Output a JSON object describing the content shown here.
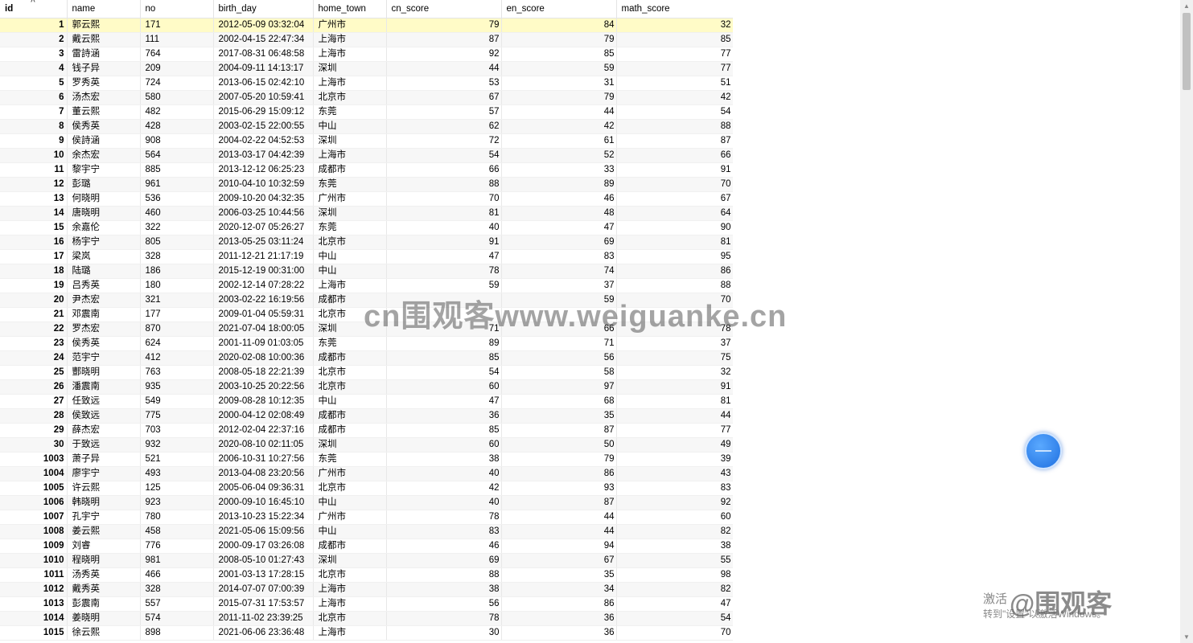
{
  "columns": [
    "id",
    "name",
    "no",
    "birth_day",
    "home_town",
    "cn_score",
    "en_score",
    "math_score"
  ],
  "rows": [
    [
      "1",
      "郭云熙",
      "171",
      "2012-05-09 03:32:04",
      "广州市",
      "79",
      "84",
      "32"
    ],
    [
      "2",
      "戴云熙",
      "111",
      "2002-04-15 22:47:34",
      "上海市",
      "87",
      "79",
      "85"
    ],
    [
      "3",
      "雷詩涵",
      "764",
      "2017-08-31 06:48:58",
      "上海市",
      "92",
      "85",
      "77"
    ],
    [
      "4",
      "钱子异",
      "209",
      "2004-09-11 14:13:17",
      "深圳",
      "44",
      "59",
      "77"
    ],
    [
      "5",
      "罗秀英",
      "724",
      "2013-06-15 02:42:10",
      "上海市",
      "53",
      "31",
      "51"
    ],
    [
      "6",
      "汤杰宏",
      "580",
      "2007-05-20 10:59:41",
      "北京市",
      "67",
      "79",
      "42"
    ],
    [
      "7",
      "董云熙",
      "482",
      "2015-06-29 15:09:12",
      "东莞",
      "57",
      "44",
      "54"
    ],
    [
      "8",
      "侯秀英",
      "428",
      "2003-02-15 22:00:55",
      "中山",
      "62",
      "42",
      "88"
    ],
    [
      "9",
      "侯詩涵",
      "908",
      "2004-02-22 04:52:53",
      "深圳",
      "72",
      "61",
      "87"
    ],
    [
      "10",
      "余杰宏",
      "564",
      "2013-03-17 04:42:39",
      "上海市",
      "54",
      "52",
      "66"
    ],
    [
      "11",
      "黎宇宁",
      "885",
      "2013-12-12 06:25:23",
      "成都市",
      "66",
      "33",
      "91"
    ],
    [
      "12",
      "彭璐",
      "961",
      "2010-04-10 10:32:59",
      "东莞",
      "88",
      "89",
      "70"
    ],
    [
      "13",
      "何晓明",
      "536",
      "2009-10-20 04:32:35",
      "广州市",
      "70",
      "46",
      "67"
    ],
    [
      "14",
      "唐晓明",
      "460",
      "2006-03-25 10:44:56",
      "深圳",
      "81",
      "48",
      "64"
    ],
    [
      "15",
      "余嘉伦",
      "322",
      "2020-12-07 05:26:27",
      "东莞",
      "40",
      "47",
      "90"
    ],
    [
      "16",
      "杨宇宁",
      "805",
      "2013-05-25 03:11:24",
      "北京市",
      "91",
      "69",
      "81"
    ],
    [
      "17",
      "梁岚",
      "328",
      "2011-12-21 21:17:19",
      "中山",
      "47",
      "83",
      "95"
    ],
    [
      "18",
      "陆璐",
      "186",
      "2015-12-19 00:31:00",
      "中山",
      "78",
      "74",
      "86"
    ],
    [
      "19",
      "吕秀英",
      "180",
      "2002-12-14 07:28:22",
      "上海市",
      "59",
      "37",
      "88"
    ],
    [
      "20",
      "尹杰宏",
      "321",
      "2003-02-22 16:19:56",
      "成都市",
      "",
      "59",
      "70"
    ],
    [
      "21",
      "邓震南",
      "177",
      "2009-01-04 05:59:31",
      "北京市",
      "",
      "",
      "",
      ""
    ],
    [
      "22",
      "罗杰宏",
      "870",
      "2021-07-04 18:00:05",
      "深圳",
      "71",
      "66",
      "78"
    ],
    [
      "23",
      "侯秀英",
      "624",
      "2001-11-09 01:03:05",
      "东莞",
      "89",
      "71",
      "37"
    ],
    [
      "24",
      "范宇宁",
      "412",
      "2020-02-08 10:00:36",
      "成都市",
      "85",
      "56",
      "75"
    ],
    [
      "25",
      "酆晓明",
      "763",
      "2008-05-18 22:21:39",
      "北京市",
      "54",
      "58",
      "32"
    ],
    [
      "26",
      "潘震南",
      "935",
      "2003-10-25 20:22:56",
      "北京市",
      "60",
      "97",
      "91"
    ],
    [
      "27",
      "任致远",
      "549",
      "2009-08-28 10:12:35",
      "中山",
      "47",
      "68",
      "81"
    ],
    [
      "28",
      "侯致远",
      "775",
      "2000-04-12 02:08:49",
      "成都市",
      "36",
      "35",
      "44"
    ],
    [
      "29",
      "薛杰宏",
      "703",
      "2012-02-04 22:37:16",
      "成都市",
      "85",
      "87",
      "77"
    ],
    [
      "30",
      "于致远",
      "932",
      "2020-08-10 02:11:05",
      "深圳",
      "60",
      "50",
      "49"
    ],
    [
      "1003",
      "萧子异",
      "521",
      "2006-10-31 10:27:56",
      "东莞",
      "38",
      "79",
      "39"
    ],
    [
      "1004",
      "廖宇宁",
      "493",
      "2013-04-08 23:20:56",
      "广州市",
      "40",
      "86",
      "43"
    ],
    [
      "1005",
      "许云熙",
      "125",
      "2005-06-04 09:36:31",
      "北京市",
      "42",
      "93",
      "83"
    ],
    [
      "1006",
      "韩晓明",
      "923",
      "2000-09-10 16:45:10",
      "中山",
      "40",
      "87",
      "92"
    ],
    [
      "1007",
      "孔宇宁",
      "780",
      "2013-10-23 15:22:34",
      "广州市",
      "78",
      "44",
      "60"
    ],
    [
      "1008",
      "姜云熙",
      "458",
      "2021-05-06 15:09:56",
      "中山",
      "83",
      "44",
      "82"
    ],
    [
      "1009",
      "刘睿",
      "776",
      "2000-09-17 03:26:08",
      "成都市",
      "46",
      "94",
      "38"
    ],
    [
      "1010",
      "程晓明",
      "981",
      "2008-05-10 01:27:43",
      "深圳",
      "69",
      "67",
      "55"
    ],
    [
      "1011",
      "汤秀英",
      "466",
      "2001-03-13 17:28:15",
      "北京市",
      "88",
      "35",
      "98"
    ],
    [
      "1012",
      "戴秀英",
      "328",
      "2014-07-07 07:00:39",
      "上海市",
      "38",
      "34",
      "82"
    ],
    [
      "1013",
      "彭震南",
      "557",
      "2015-07-31 17:53:57",
      "上海市",
      "56",
      "86",
      "47"
    ],
    [
      "1014",
      "姜晓明",
      "574",
      "2011-11-02 23:39:25",
      "北京市",
      "78",
      "36",
      "54"
    ],
    [
      "1015",
      "徐云熙",
      "898",
      "2021-06-06 23:36:48",
      "上海市",
      "30",
      "36",
      "70"
    ]
  ],
  "selected_row_index": 0,
  "sort_indicator": "^",
  "watermark_text": "cn围观客www.weiguanke.cn",
  "overlay": {
    "activate_line1": "激活",
    "activate_line2": "转到\"设置\"以激活Windows。",
    "brand_text": "@围观客"
  },
  "colors": {
    "selected_row": "#fffbc7",
    "alt_row": "#f7f7f7"
  }
}
